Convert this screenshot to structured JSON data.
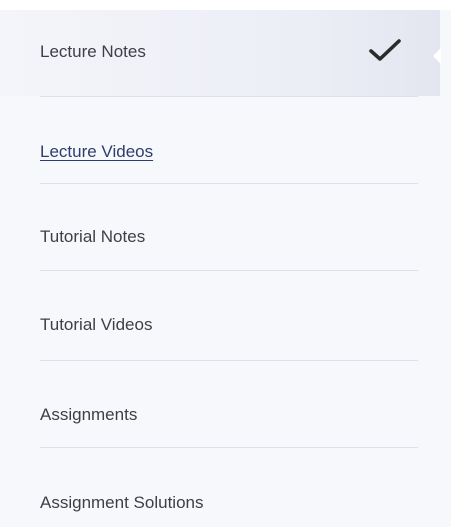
{
  "menu": {
    "items": [
      {
        "label": "Lecture Notes",
        "state": "completed"
      },
      {
        "label": "Lecture Videos",
        "state": "link"
      },
      {
        "label": "Tutorial Notes",
        "state": "normal"
      },
      {
        "label": "Tutorial Videos",
        "state": "normal"
      },
      {
        "label": "Assignments",
        "state": "normal"
      },
      {
        "label": "Assignment Solutions",
        "state": "normal"
      }
    ],
    "icons": {
      "completed": "checkmark-icon"
    },
    "colors": {
      "background": "#f7f8fc",
      "active_background": "#eceef6",
      "text": "#3d3f46",
      "link": "#2d3e6e",
      "divider": "#dcdfe7"
    }
  }
}
